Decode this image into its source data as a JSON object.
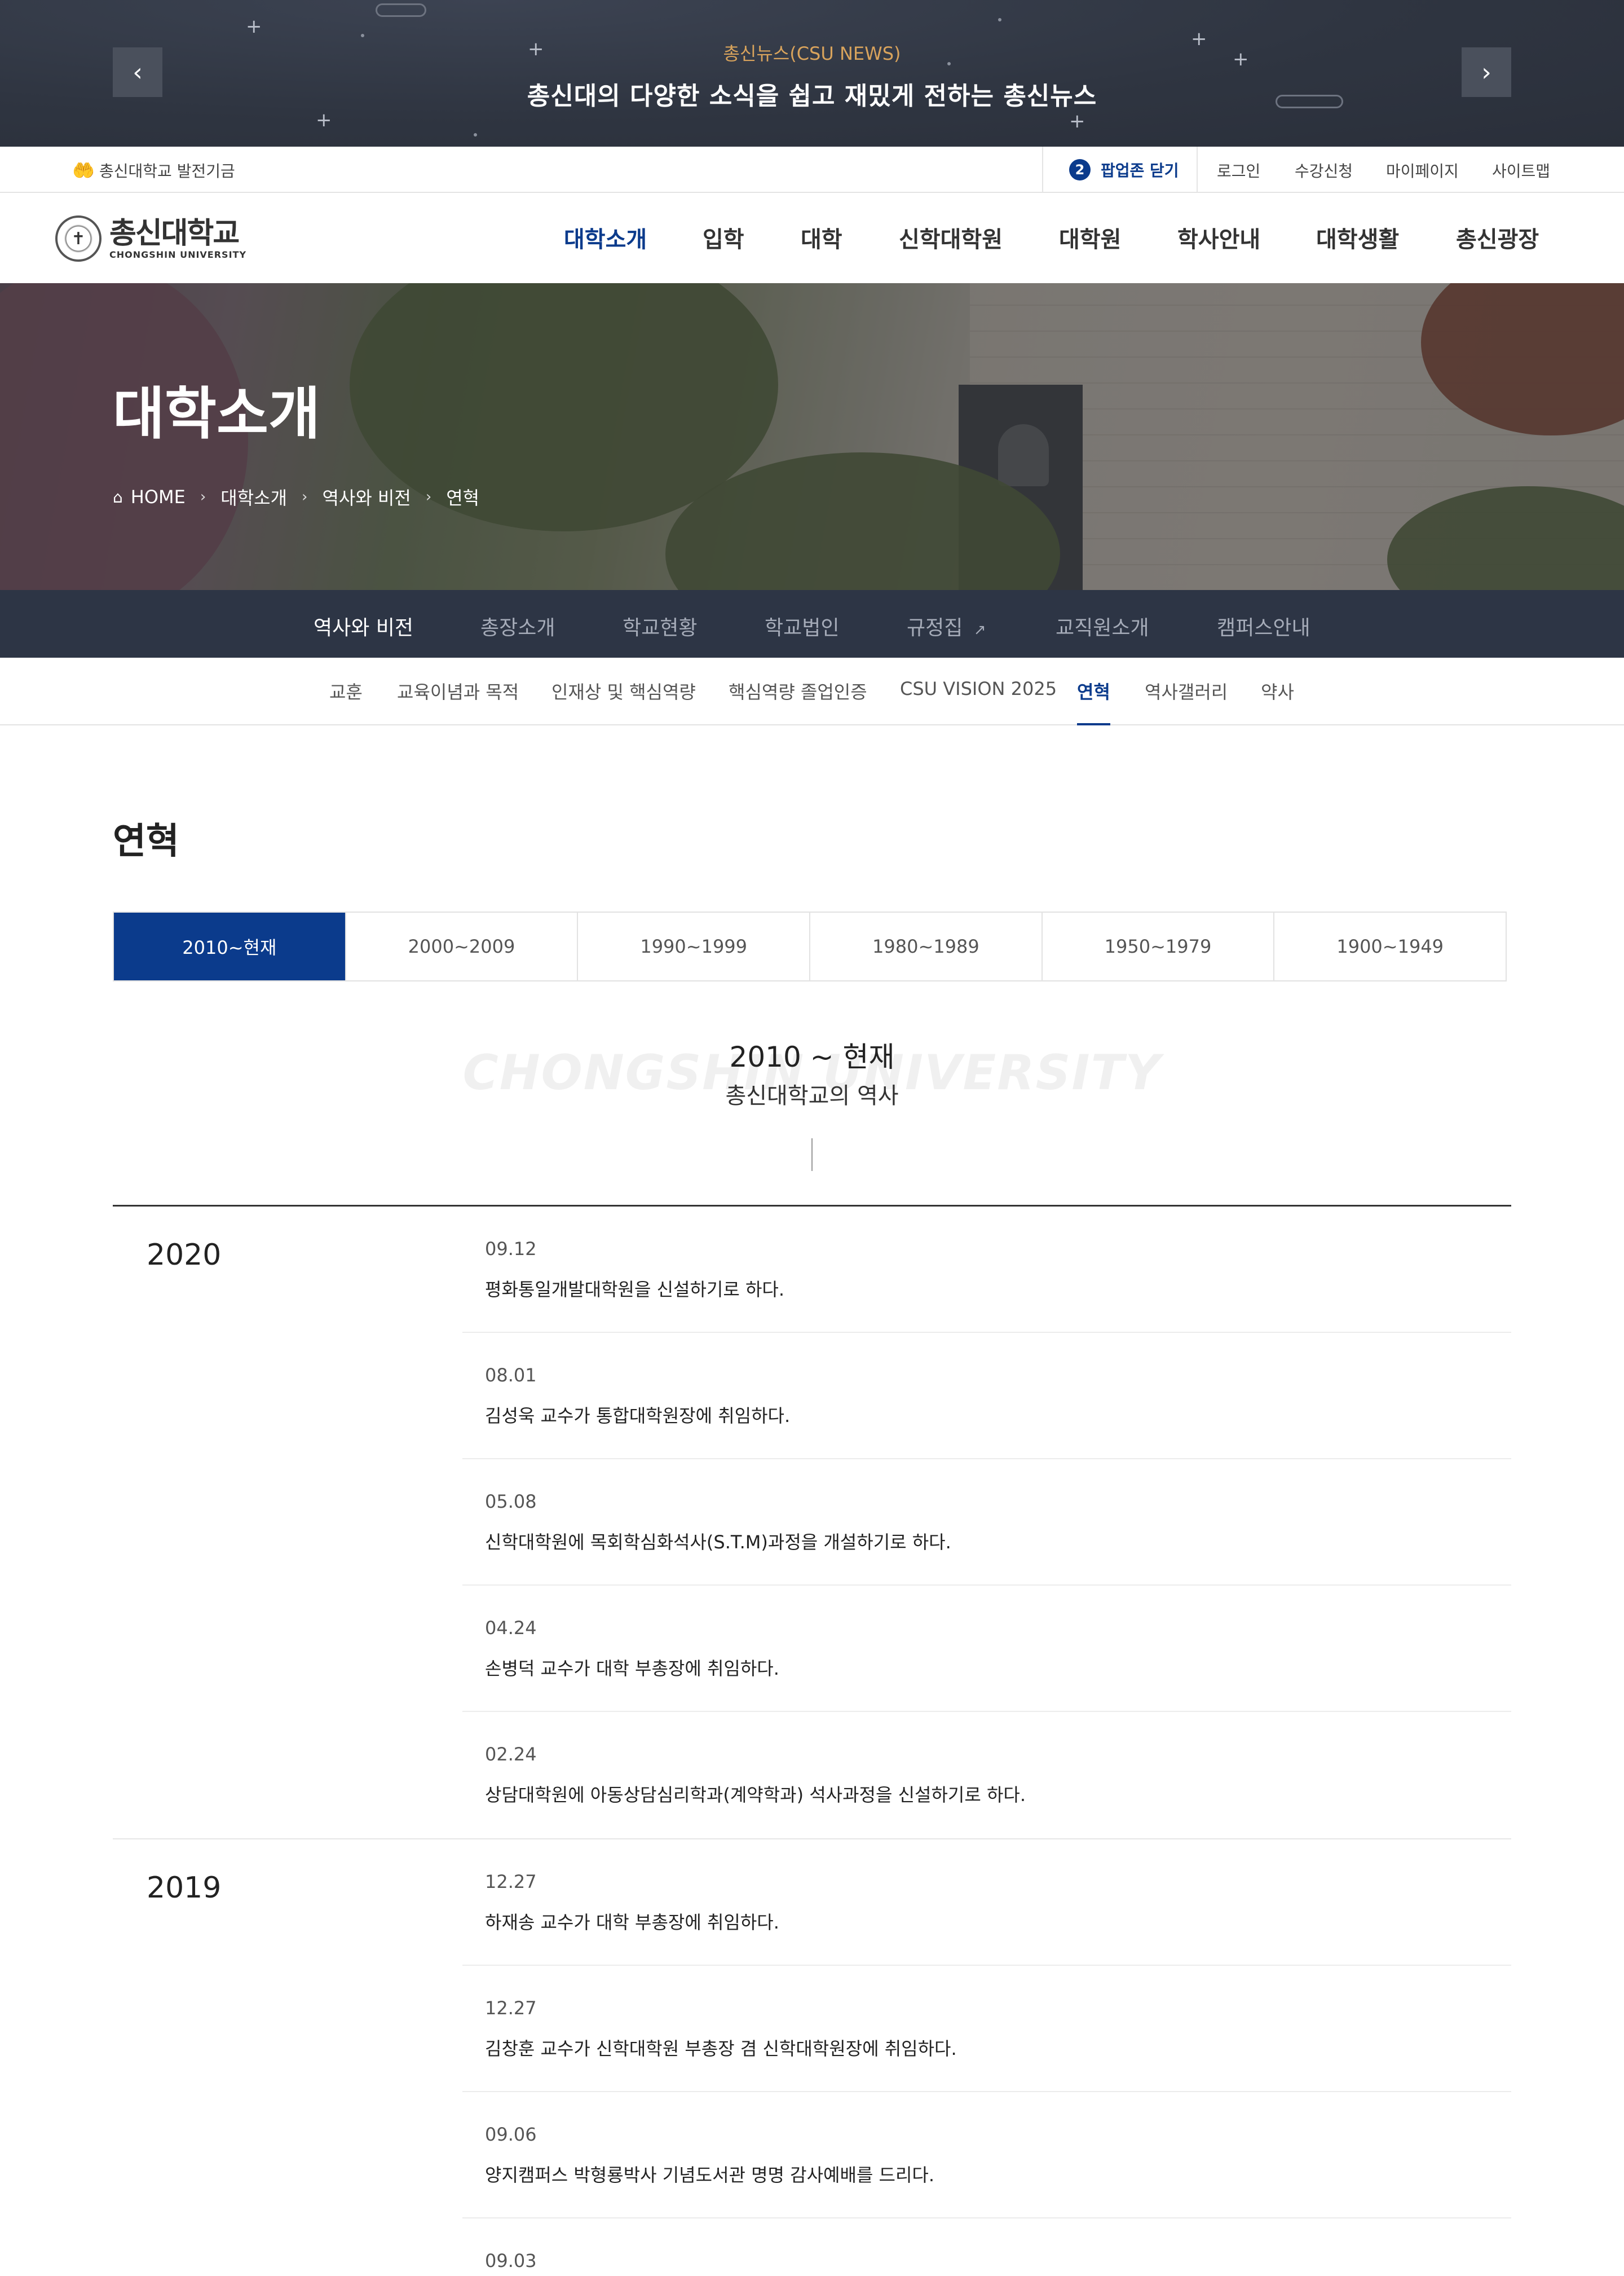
{
  "popup": {
    "kicker": "총신뉴스(CSU NEWS)",
    "headline": "총신대의 다양한 소식을 쉽고 재밌게 전하는 총신뉴스",
    "prev_icon": "chevron-left-icon",
    "next_icon": "chevron-right-icon"
  },
  "utility": {
    "fund_label": "총신대학교 발전기금",
    "popup_count": "2",
    "popup_close_label": "팝업존 닫기",
    "links": [
      "로그인",
      "수강신청",
      "마이페이지",
      "사이트맵"
    ]
  },
  "logo": {
    "name_ko": "총신대학교",
    "name_en": "CHONGSHIN UNIVERSITY"
  },
  "gnb": [
    "대학소개",
    "입학",
    "대학",
    "신학대학원",
    "대학원",
    "학사안내",
    "대학생활",
    "총신광장"
  ],
  "hero": {
    "title": "대학소개",
    "breadcrumb": [
      "HOME",
      "대학소개",
      "역사와 비전",
      "연혁"
    ]
  },
  "lnb": [
    "역사와 비전",
    "총장소개",
    "학교현황",
    "학교법인",
    "규정집",
    "교직원소개",
    "캠퍼스안내"
  ],
  "snb": [
    "교훈",
    "교육이념과 목적",
    "인재상 및 핵심역량",
    "핵심역량 졸업인증",
    "CSU VISION 2025",
    "연혁",
    "역사갤러리",
    "약사"
  ],
  "content": {
    "page_title": "연혁",
    "tabs": [
      "2010~현재",
      "2000~2009",
      "1990~1999",
      "1980~1989",
      "1950~1979",
      "1900~1949"
    ],
    "era_watermark": "CHONGSHIN UNIVERSITY",
    "era_range": "2010 ~ 현재",
    "era_sub": "총신대학교의 역사",
    "years": [
      {
        "year": "2020",
        "events": [
          {
            "date": "09.12",
            "desc": "평화통일개발대학원을 신설하기로 하다."
          },
          {
            "date": "08.01",
            "desc": "김성욱 교수가 통합대학원장에 취임하다."
          },
          {
            "date": "05.08",
            "desc": "신학대학원에 목회학심화석사(S.T.M)과정을 개설하기로 하다."
          },
          {
            "date": "04.24",
            "desc": "손병덕 교수가 대학 부총장에 취임하다."
          },
          {
            "date": "02.24",
            "desc": "상담대학원에 아동상담심리학과(계약학과) 석사과정을 신설하기로 하다."
          }
        ]
      },
      {
        "year": "2019",
        "events": [
          {
            "date": "12.27",
            "desc": "하재송 교수가 대학 부총장에 취임하다."
          },
          {
            "date": "12.27",
            "desc": "김창훈 교수가 신학대학원 부총장 겸 신학대학원장에 취임하다."
          },
          {
            "date": "09.06",
            "desc": "양지캠퍼스 박형룡박사 기념도서관 명명 감사예배를 드리다."
          },
          {
            "date": "09.03",
            "desc": ""
          }
        ]
      }
    ]
  },
  "colors": {
    "brand_navy": "#0b3b8c",
    "lnb_bg": "#2d3545",
    "popup_accent": "#d8a35c"
  }
}
